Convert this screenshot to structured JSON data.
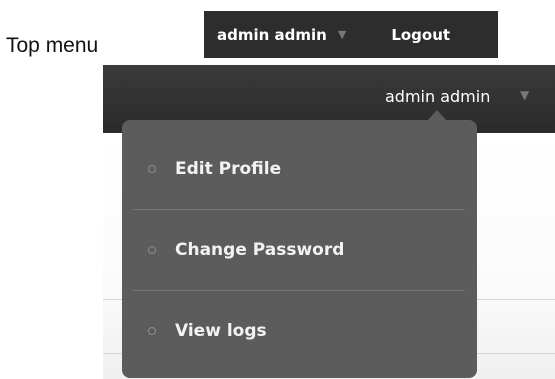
{
  "caption": "Top menu",
  "mini_bar": {
    "user_label": "admin admin",
    "logout_label": "Logout"
  },
  "topbar": {
    "user_label": "admin admin"
  },
  "dropdown": {
    "items": [
      {
        "label": "Edit Profile",
        "icon": "circle-bullet-icon"
      },
      {
        "label": "Change Password",
        "icon": "circle-bullet-icon"
      },
      {
        "label": "View logs",
        "icon": "circle-bullet-icon"
      }
    ]
  },
  "colors": {
    "bar_background": "#2d2d2d",
    "dropdown_background": "#5c5c5c",
    "caret": "#777777"
  }
}
